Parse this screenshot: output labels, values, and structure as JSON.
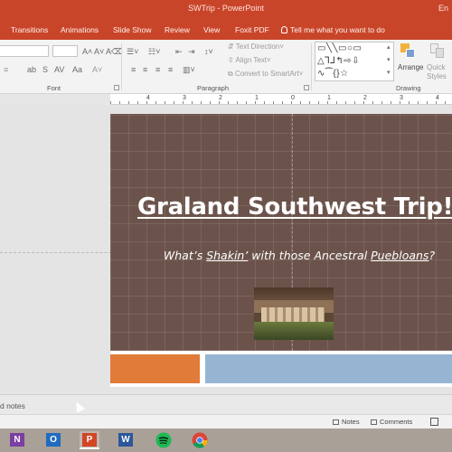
{
  "window": {
    "title": "SWTrip - PowerPoint",
    "account_initial": "En"
  },
  "tabs": [
    {
      "label": "Transitions"
    },
    {
      "label": "Animations"
    },
    {
      "label": "Slide Show"
    },
    {
      "label": "Review"
    },
    {
      "label": "View"
    },
    {
      "label": "Foxit PDF"
    }
  ],
  "tell_me": "Tell me what you want to do",
  "ribbon": {
    "text_direction": "Text Direction",
    "align_text": "Align Text",
    "convert_smartart": "Convert to SmartArt",
    "arrange_label": "Arrange",
    "quick_styles_label": "Quick Styles",
    "groups": {
      "font": "Font",
      "paragraph": "Paragraph",
      "drawing": "Drawing"
    }
  },
  "ruler": {
    "labels": [
      "4",
      "3",
      "2",
      "1",
      "0",
      "1",
      "2",
      "3",
      "4"
    ]
  },
  "slide": {
    "title": "Graland Southwest Trip!",
    "subtitle": {
      "part1": "What’s ",
      "underlined1": "Shakin’",
      "part2": " with those Ancestral ",
      "underlined2": "Puebloans",
      "part3": "?"
    },
    "colors": {
      "background": "#6b534b",
      "orange": "#e07b3a",
      "blue": "#96b5d2"
    }
  },
  "notes": {
    "label": "d notes"
  },
  "statusbar": {
    "notes": "Notes",
    "comments": "Comments"
  },
  "taskbar": {
    "apps": [
      {
        "name": "OneNote",
        "letter": "N",
        "color": "#7b3fa1"
      },
      {
        "name": "Outlook",
        "letter": "O",
        "color": "#1f6cc0"
      },
      {
        "name": "PowerPoint",
        "letter": "P",
        "color": "#d24625"
      },
      {
        "name": "Word",
        "letter": "W",
        "color": "#2b579a"
      },
      {
        "name": "Spotify",
        "letter": "",
        "color": "#1db954"
      },
      {
        "name": "Chrome",
        "letter": "",
        "color": "#4285f4"
      }
    ]
  }
}
